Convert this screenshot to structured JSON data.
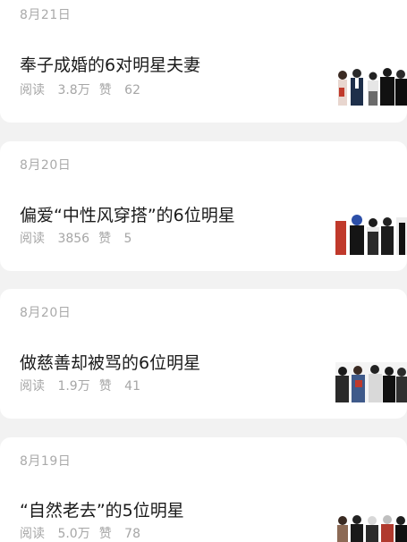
{
  "articles": [
    {
      "date": "8月21日",
      "title": "奉子成婚的6对明星夫妻",
      "reads_label": "阅读",
      "reads": "3.8万",
      "likes_label": "赞",
      "likes": "62"
    },
    {
      "date": "8月20日",
      "title": "偏爱“中性风穿搭”的6位明星",
      "reads_label": "阅读",
      "reads": "3856",
      "likes_label": "赞",
      "likes": "5"
    },
    {
      "date": "8月20日",
      "title": "做慈善却被骂的6位明星",
      "reads_label": "阅读",
      "reads": "1.9万",
      "likes_label": "赞",
      "likes": "41"
    },
    {
      "date": "8月19日",
      "title": "“自然老去”的5位明星",
      "reads_label": "阅读",
      "reads": "5.0万",
      "likes_label": "赞",
      "likes": "78"
    }
  ]
}
